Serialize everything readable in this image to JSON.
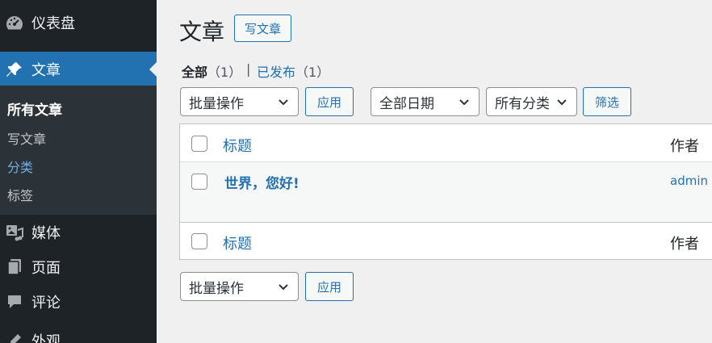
{
  "sidebar": {
    "items": [
      {
        "label": "仪表盘",
        "icon": "dashboard-icon"
      },
      {
        "label": "文章",
        "icon": "pin-icon"
      },
      {
        "label": "媒体",
        "icon": "media-icon"
      },
      {
        "label": "页面",
        "icon": "pages-icon"
      },
      {
        "label": "评论",
        "icon": "comment-icon"
      },
      {
        "label": "外观",
        "icon": "appearance-icon"
      }
    ],
    "submenu": [
      "所有文章",
      "写文章",
      "分类",
      "标签"
    ]
  },
  "colors": {
    "sidebar_bg": "#1d2327",
    "submenu_bg": "#2c3338",
    "accent": "#2271b1",
    "link_hover": "#72aee6"
  },
  "header": {
    "title": "文章",
    "add_new_label": "写文章"
  },
  "filters": {
    "all_label": "全部",
    "all_count": "（1）",
    "separator": "|",
    "published_label": "已发布",
    "published_count": "（1）"
  },
  "toolbar": {
    "bulk_action": "批量操作",
    "apply": "应用",
    "date_filter": "全部日期",
    "category_filter": "所有分类",
    "filter_button": "筛选"
  },
  "table": {
    "columns": {
      "title": "标题",
      "author": "作者"
    },
    "rows": [
      {
        "title": "世界，您好!",
        "author": "admin"
      }
    ]
  },
  "bottom_toolbar": {
    "bulk_action": "批量操作",
    "apply": "应用"
  }
}
